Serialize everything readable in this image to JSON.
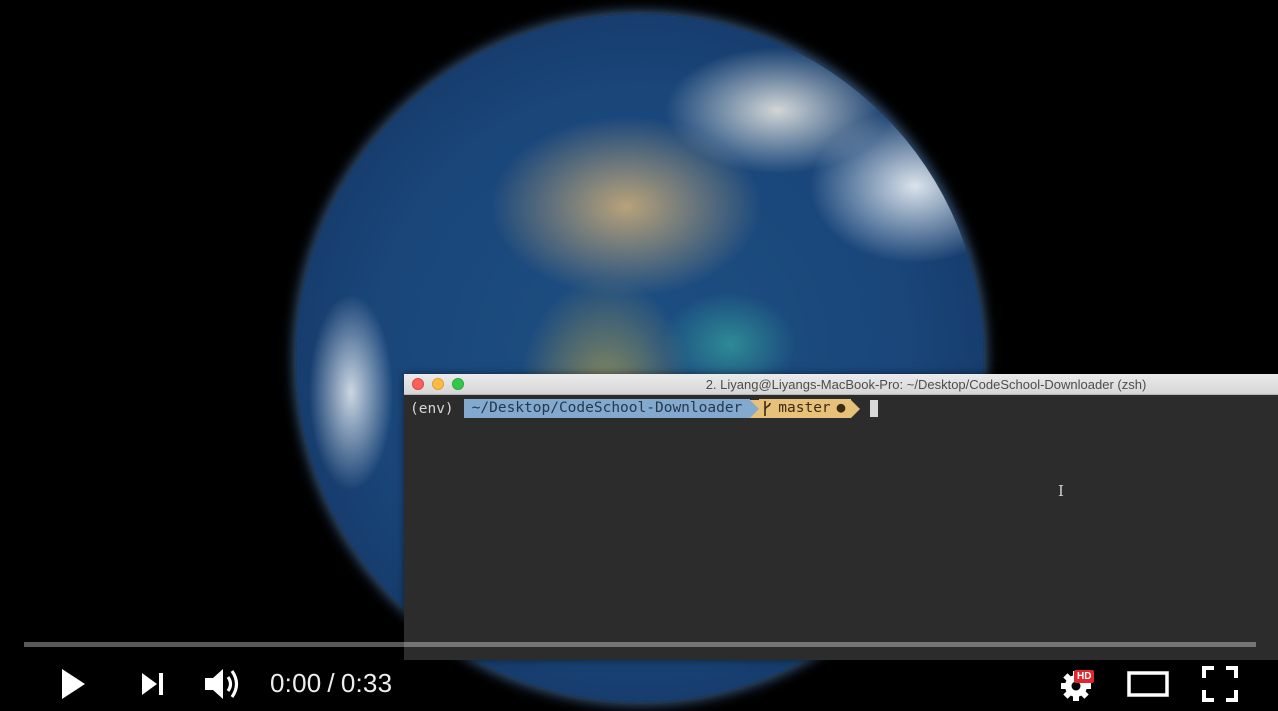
{
  "terminal": {
    "title": "2. Liyang@Liyangs-MacBook-Pro: ~/Desktop/CodeSchool-Downloader (zsh)",
    "env": "(env)",
    "path": "~/Desktop/CodeSchool-Downloader",
    "branch": "master",
    "status_dot": "●"
  },
  "player": {
    "current_time": "0:00",
    "separator": "/",
    "duration": "0:33",
    "hd_label": "HD",
    "progress": 0,
    "icons": [
      "play-icon",
      "next-icon",
      "volume-icon",
      "settings-icon",
      "theater-mode-icon",
      "fullscreen-icon"
    ]
  }
}
